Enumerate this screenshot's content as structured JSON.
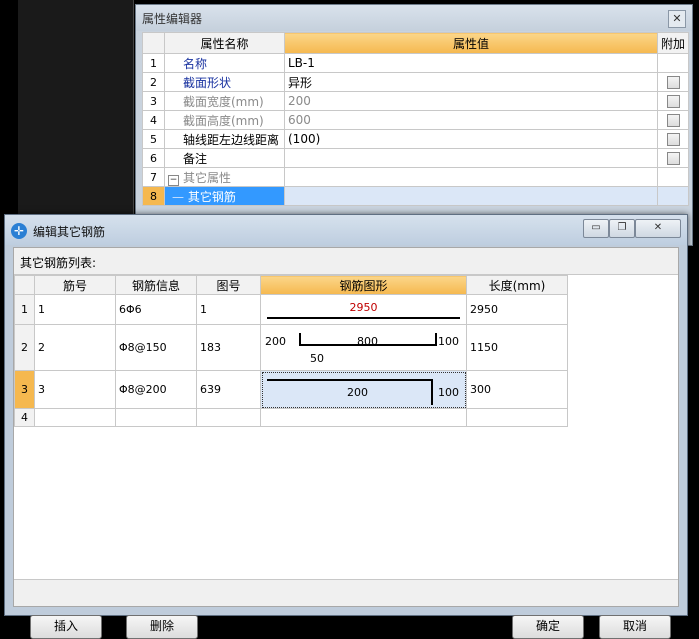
{
  "prop_editor": {
    "title": "属性编辑器",
    "close": "✕",
    "headers": {
      "index": "",
      "name": "属性名称",
      "value": "属性值",
      "extra": "附加"
    },
    "rows": [
      {
        "n": "1",
        "name": "名称",
        "value": "LB-1"
      },
      {
        "n": "2",
        "name": "截面形状",
        "value": "异形"
      },
      {
        "n": "3",
        "name": "截面宽度(mm)",
        "value": "200"
      },
      {
        "n": "4",
        "name": "截面高度(mm)",
        "value": "600"
      },
      {
        "n": "5",
        "name": "轴线距左边线距离",
        "value": "(100)"
      },
      {
        "n": "6",
        "name": "备注",
        "value": ""
      },
      {
        "n": "7",
        "name": "其它属性",
        "value": ""
      },
      {
        "n": "8",
        "name": "其它钢筋",
        "value": ""
      }
    ]
  },
  "dialog": {
    "title": "编辑其它钢筋",
    "minimize": "▭",
    "restore": "❐",
    "close": "✕",
    "list_label": "其它钢筋列表:",
    "columns": [
      "",
      "筋号",
      "钢筋信息",
      "图号",
      "钢筋图形",
      "长度(mm)"
    ],
    "rows": [
      {
        "n": "1",
        "id": "1",
        "info": "6Φ6",
        "fig": "1",
        "length": "2950",
        "shape": {
          "top": "2950"
        }
      },
      {
        "n": "2",
        "id": "2",
        "info": "Φ8@150",
        "fig": "183",
        "length": "1150",
        "shape": {
          "left": "200",
          "mid": "800",
          "right": "100",
          "bottom": "50"
        }
      },
      {
        "n": "3",
        "id": "3",
        "info": "Φ8@200",
        "fig": "639",
        "length": "300",
        "shape": {
          "mid": "200",
          "right": "100"
        }
      },
      {
        "n": "4",
        "id": "",
        "info": "",
        "fig": "",
        "length": "",
        "shape": {}
      }
    ],
    "buttons": {
      "insert": "插入",
      "delete": "删除",
      "ok": "确定",
      "cancel": "取消"
    }
  }
}
